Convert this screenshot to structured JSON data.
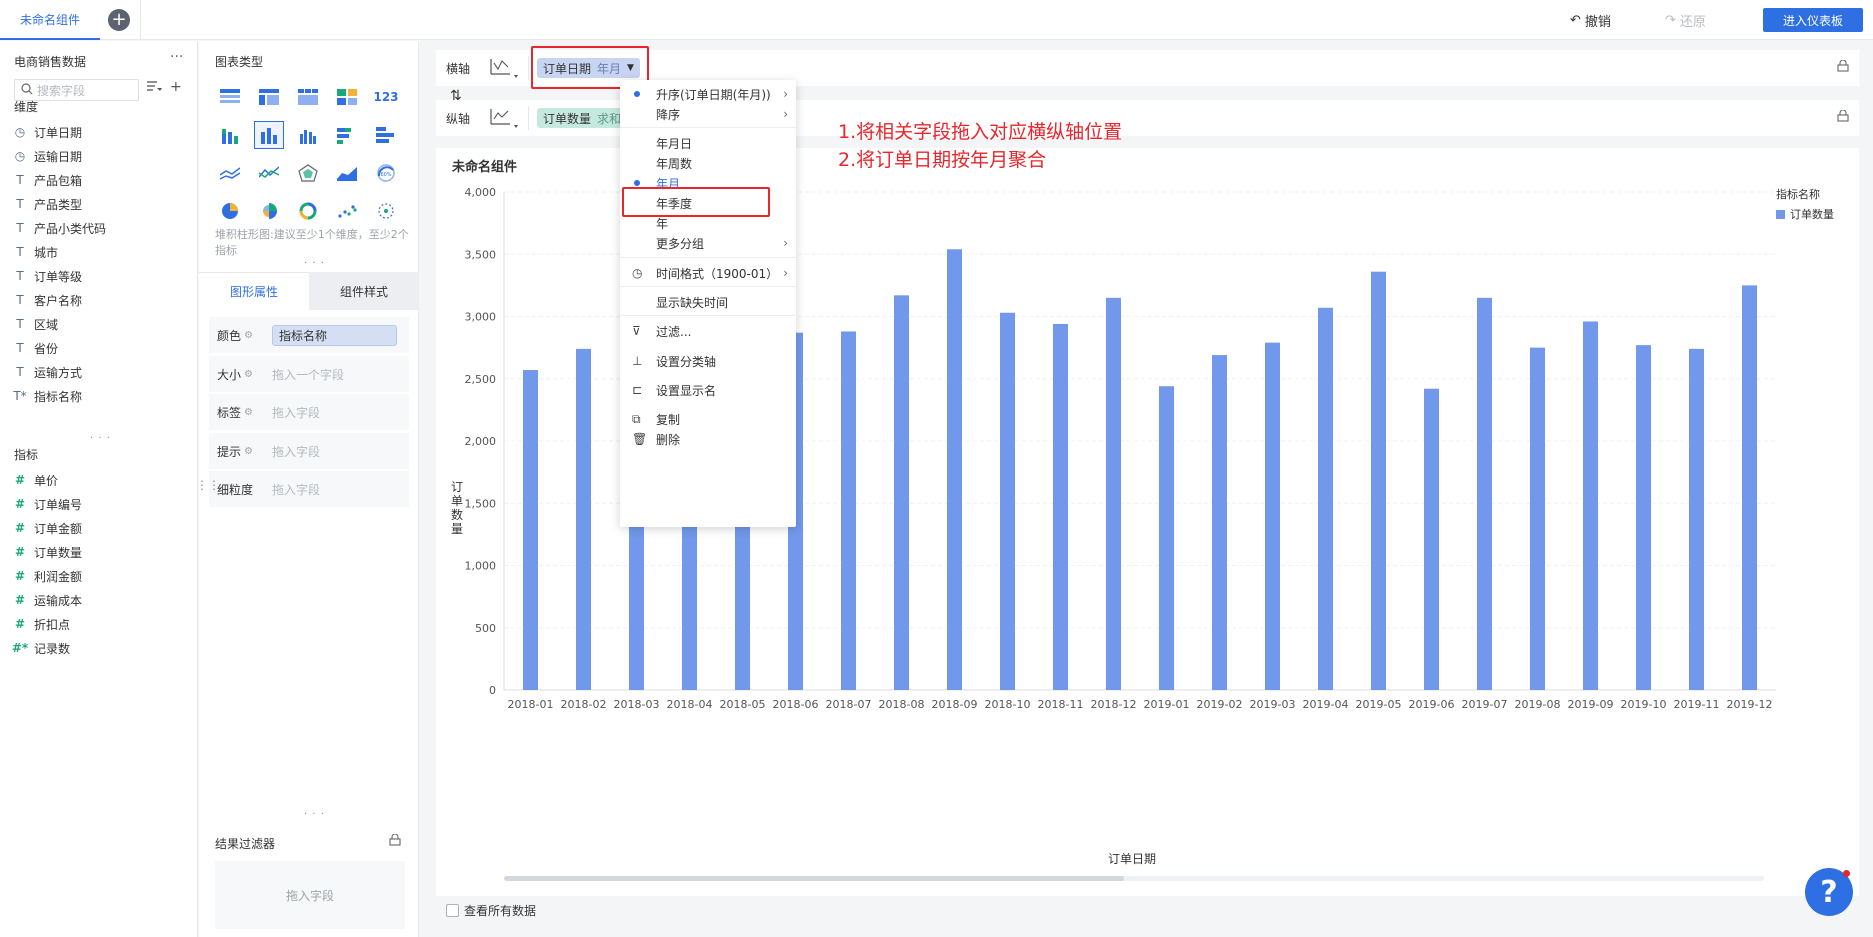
{
  "topbar": {
    "active_tab": "未命名组件",
    "add_tab_label": "+",
    "undo_label": "撤销",
    "redo_label": "还原",
    "enter_dashboard_label": "进入仪表板"
  },
  "data_panel": {
    "dataset_name": "电商销售数据",
    "more_label": "···",
    "search_placeholder": "搜索字段",
    "dimensions_label": "维度",
    "dimensions": [
      {
        "icon": "clock-icon",
        "glyph": "◷",
        "label": "订单日期"
      },
      {
        "icon": "clock-icon",
        "glyph": "◷",
        "label": "运输日期"
      },
      {
        "icon": "text-icon",
        "glyph": "T",
        "label": "产品包箱"
      },
      {
        "icon": "text-icon",
        "glyph": "T",
        "label": "产品类型"
      },
      {
        "icon": "text-icon",
        "glyph": "T",
        "label": "产品小类代码"
      },
      {
        "icon": "text-icon",
        "glyph": "T",
        "label": "城市"
      },
      {
        "icon": "text-icon",
        "glyph": "T",
        "label": "订单等级"
      },
      {
        "icon": "text-icon",
        "glyph": "T",
        "label": "客户名称"
      },
      {
        "icon": "text-icon",
        "glyph": "T",
        "label": "区域"
      },
      {
        "icon": "text-icon",
        "glyph": "T",
        "label": "省份"
      },
      {
        "icon": "text-icon",
        "glyph": "T",
        "label": "运输方式"
      },
      {
        "icon": "text-icon",
        "glyph": "T*",
        "label": "指标名称"
      }
    ],
    "measures_label": "指标",
    "measures": [
      {
        "icon": "hash-icon",
        "glyph": "#",
        "label": "单价"
      },
      {
        "icon": "hash-icon",
        "glyph": "#",
        "label": "订单编号"
      },
      {
        "icon": "hash-icon",
        "glyph": "#",
        "label": "订单金额"
      },
      {
        "icon": "hash-icon",
        "glyph": "#",
        "label": "订单数量"
      },
      {
        "icon": "hash-icon",
        "glyph": "#",
        "label": "利润金额"
      },
      {
        "icon": "hash-icon",
        "glyph": "#",
        "label": "运输成本"
      },
      {
        "icon": "hash-icon",
        "glyph": "#",
        "label": "折扣点"
      },
      {
        "icon": "hash-icon",
        "glyph": "#*",
        "label": "记录数"
      }
    ]
  },
  "config_panel": {
    "chart_type_title": "图表类型",
    "chart_type_hint": "堆积柱形图:建议至少1个维度，至少2个指标",
    "tab_graph_props": "图形属性",
    "tab_component_style": "组件样式",
    "props": [
      {
        "label": "颜色",
        "value": "指标名称",
        "filled": true
      },
      {
        "label": "大小",
        "value": "拖入一个字段",
        "filled": false
      },
      {
        "label": "标签",
        "value": "拖入字段",
        "filled": false
      },
      {
        "label": "提示",
        "value": "拖入字段",
        "filled": false
      },
      {
        "label": "细粒度",
        "value": "拖入字段",
        "filled": false
      }
    ],
    "result_filter_title": "结果过滤器",
    "result_filter_placeholder": "拖入字段"
  },
  "axes": {
    "x_label": "横轴",
    "x_field": "订单日期",
    "x_sub": "年月",
    "y_label": "纵轴",
    "y_field": "订单数量",
    "y_sub": "求和"
  },
  "dropdown": {
    "items": [
      {
        "label": "升序(订单日期(年月))",
        "dot": true,
        "arrow": true
      },
      {
        "label": "降序",
        "dot": false,
        "arrow": true
      },
      {
        "label": "年月日"
      },
      {
        "label": "年周数"
      },
      {
        "label": "年月",
        "active": true
      },
      {
        "label": "年季度"
      },
      {
        "label": "年"
      },
      {
        "label": "更多分组",
        "arrow": true
      },
      {
        "label": "时间格式（1900-01）",
        "icon": "clock-icon",
        "arrow": true
      },
      {
        "label": "显示缺失时间"
      },
      {
        "label": "过滤...",
        "icon": "filter-icon"
      },
      {
        "label": "设置分类轴",
        "icon": "axis-icon"
      },
      {
        "label": "设置显示名",
        "icon": "rename-icon"
      },
      {
        "label": "复制",
        "icon": "copy-icon"
      },
      {
        "label": "删除",
        "icon": "trash-icon"
      }
    ]
  },
  "annotation": {
    "line1": "1.将相关字段拖入对应横纵轴位置",
    "line2": "2.将订单日期按年月聚合"
  },
  "chart": {
    "title": "未命名组件",
    "legend_title": "指标名称",
    "view_all_label": "查看所有数据",
    "bar_color": "#7198ea"
  },
  "chart_data": {
    "type": "bar",
    "xlabel": "订单日期",
    "ylabel": "订单数量",
    "ylim": [
      0,
      4000
    ],
    "yticks": [
      0,
      500,
      1000,
      1500,
      2000,
      2500,
      3000,
      3500,
      4000
    ],
    "ytick_labels": [
      "0",
      "500",
      "1,000",
      "1,500",
      "2,000",
      "2,500",
      "3,000",
      "3,500",
      "4,000"
    ],
    "legend_position": "top-right",
    "grid": true,
    "categories": [
      "2018-01",
      "2018-02",
      "2018-03",
      "2018-04",
      "2018-05",
      "2018-06",
      "2018-07",
      "2018-08",
      "2018-09",
      "2018-10",
      "2018-11",
      "2018-12",
      "2019-01",
      "2019-02",
      "2019-03",
      "2019-04",
      "2019-05",
      "2019-06",
      "2019-07",
      "2019-08",
      "2019-09",
      "2019-10",
      "2019-11",
      "2019-12"
    ],
    "series": [
      {
        "name": "订单数量",
        "values": [
          2570,
          2740,
          2500,
          2400,
          2480,
          2870,
          2880,
          3170,
          3540,
          3030,
          2940,
          3150,
          2440,
          2690,
          2790,
          3070,
          3360,
          2420,
          3150,
          2750,
          2960,
          2770,
          2740,
          3250
        ]
      }
    ]
  }
}
